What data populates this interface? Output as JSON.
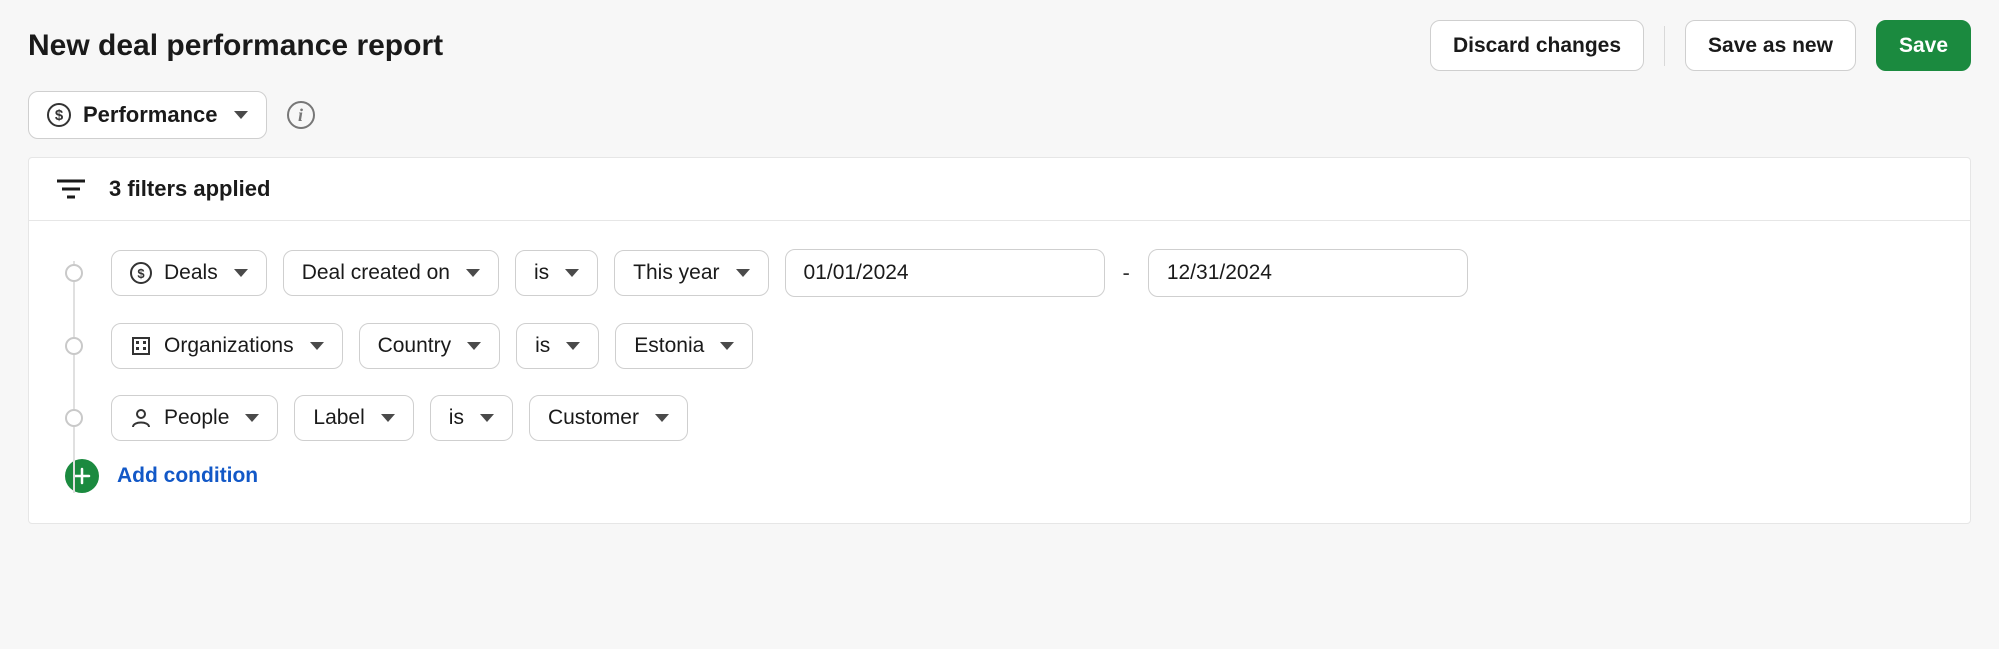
{
  "header": {
    "title": "New deal performance report",
    "discard_label": "Discard changes",
    "save_as_new_label": "Save as new",
    "save_label": "Save"
  },
  "report_type": {
    "label": "Performance"
  },
  "filters": {
    "summary": "3 filters applied",
    "add_condition_label": "Add condition",
    "rows": [
      {
        "entity": "Deals",
        "field": "Deal created on",
        "operator": "is",
        "preset": "This year",
        "date_from": "01/01/2024",
        "date_to": "12/31/2024"
      },
      {
        "entity": "Organizations",
        "field": "Country",
        "operator": "is",
        "value": "Estonia"
      },
      {
        "entity": "People",
        "field": "Label",
        "operator": "is",
        "value": "Customer"
      }
    ]
  }
}
